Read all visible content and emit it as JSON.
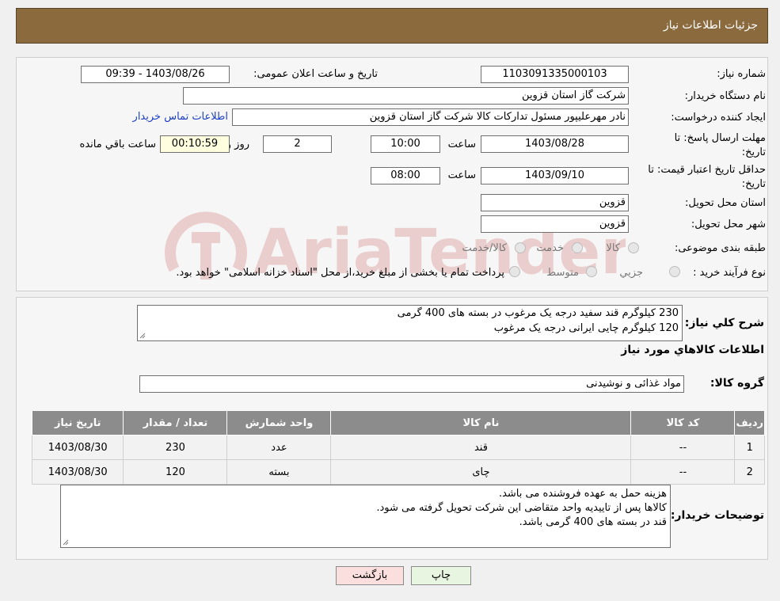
{
  "header": {
    "title": "جزئیات اطلاعات نیاز"
  },
  "form": {
    "need_number_label": "شماره نیاز:",
    "need_number": "1103091335000103",
    "announce_label": "تاریخ و ساعت اعلان عمومی:",
    "announce_value": "1403/08/26 - 09:39",
    "buyer_org_label": "نام دستگاه خریدار:",
    "buyer_org": "شرکت گاز استان قزوین",
    "creator_label": "ایجاد کننده درخواست:",
    "creator": "نادر مهرعلیپور مسئول تدارکات کالا شرکت گاز استان قزوین",
    "buyer_contact_link": "اطلاعات تماس خریدار",
    "deadline_label_1": "مهلت ارسال پاسخ: تا",
    "deadline_label_2": "تاریخ:",
    "deadline_date": "1403/08/28",
    "time_label": "ساعت",
    "deadline_time": "10:00",
    "days_value": "2",
    "days_label": "روز و",
    "remaining_time": "00:10:59",
    "remaining_label": "ساعت باقي مانده",
    "validity_label_1": "حداقل تاریخ اعتبار قیمت: تا",
    "validity_label_2": "تاریخ:",
    "validity_date": "1403/09/10",
    "validity_time_label": "ساعت",
    "validity_time": "08:00",
    "province_label": "استان محل تحویل:",
    "province": "قزوین",
    "city_label": "شهر محل تحویل:",
    "city": "قزوین",
    "category_label": "طبقه بندی موضوعی:",
    "category_options": [
      "کالا",
      "خدمت",
      "کالا/خدمت"
    ],
    "process_label": "نوع فرآیند خرید :",
    "process_options": [
      "جزيي",
      "متوسط"
    ],
    "process_note": "پرداخت تمام یا بخشی از مبلغ خرید،از محل \"اسناد خزانه اسلامی\" خواهد بود."
  },
  "watermark": {
    "text": "AriaTender.neT"
  },
  "description": {
    "label": "شرح كلي نياز:",
    "lines": [
      "230 کیلوگرم قند سفید درجه یک مرغوب در بسته های 400 گرمی",
      "120 کیلوگرم چایی ایرانی درجه یک مرغوب"
    ]
  },
  "goods": {
    "section_title": "اطلاعات كالاهاي مورد نياز",
    "group_label": "گروه كالا:",
    "group_value": "مواد غذائی و نوشیدنی",
    "columns": [
      "ردیف",
      "کد کالا",
      "نام کالا",
      "واحد شمارش",
      "تعداد / مقدار",
      "تاریخ نیاز"
    ],
    "rows": [
      [
        "1",
        "--",
        "قند",
        "عدد",
        "230",
        "1403/08/30"
      ],
      [
        "2",
        "--",
        "چای",
        "بسته",
        "120",
        "1403/08/30"
      ]
    ]
  },
  "buyer_notes": {
    "label": "توضیحات خریدار:",
    "lines": [
      "هزینه حمل به عهده فروشنده می باشد.",
      "کالاها پس از تاییدیه واحد متقاضی این شرکت تحویل گرفته می شود.",
      "قند در بسته های 400 گرمی باشد."
    ]
  },
  "buttons": {
    "print": "چاپ",
    "back": "بازگشت"
  },
  "colors": {
    "header": "#8b6b3e",
    "print_bg": "#e8f5e0",
    "back_bg": "#fbdede",
    "table_header": "#8c8c8c"
  }
}
